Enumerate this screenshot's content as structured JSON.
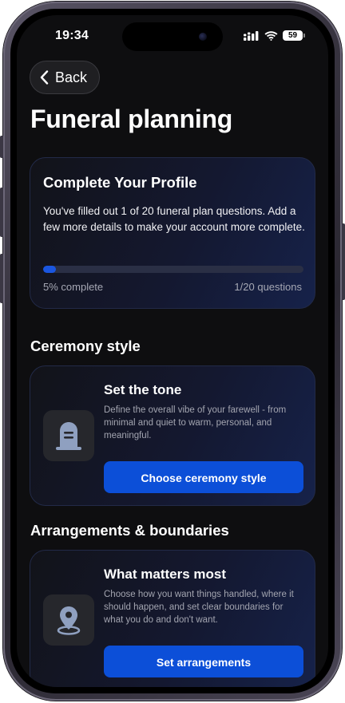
{
  "status_bar": {
    "time": "19:34",
    "battery": "59"
  },
  "nav": {
    "back_label": "Back"
  },
  "page": {
    "title": "Funeral planning"
  },
  "profile": {
    "title": "Complete Your Profile",
    "description": "You've filled out 1 of 20 funeral plan questions. Add a few more details to make your account more complete.",
    "progress_fraction": 0.05,
    "percent_label": "5% complete",
    "count_label": "1/20 questions"
  },
  "sections": [
    {
      "heading": "Ceremony style",
      "card_title": "Set the tone",
      "card_description": "Define the overall vibe of your farewell - from minimal and quiet to warm, personal, and meaningful.",
      "button_label": "Choose ceremony style",
      "icon": "gravestone-icon"
    },
    {
      "heading": "Arrangements & boundaries",
      "card_title": "What matters most",
      "card_description": "Choose how you want things handled, where it should happen, and set clear boundaries for what you do and don't want.",
      "button_label": "Set arrangements",
      "icon": "location-pin-icon"
    }
  ],
  "colors": {
    "accent": "#0c4fd8",
    "background": "#0e0e10",
    "icon": "#8fa0c0"
  }
}
